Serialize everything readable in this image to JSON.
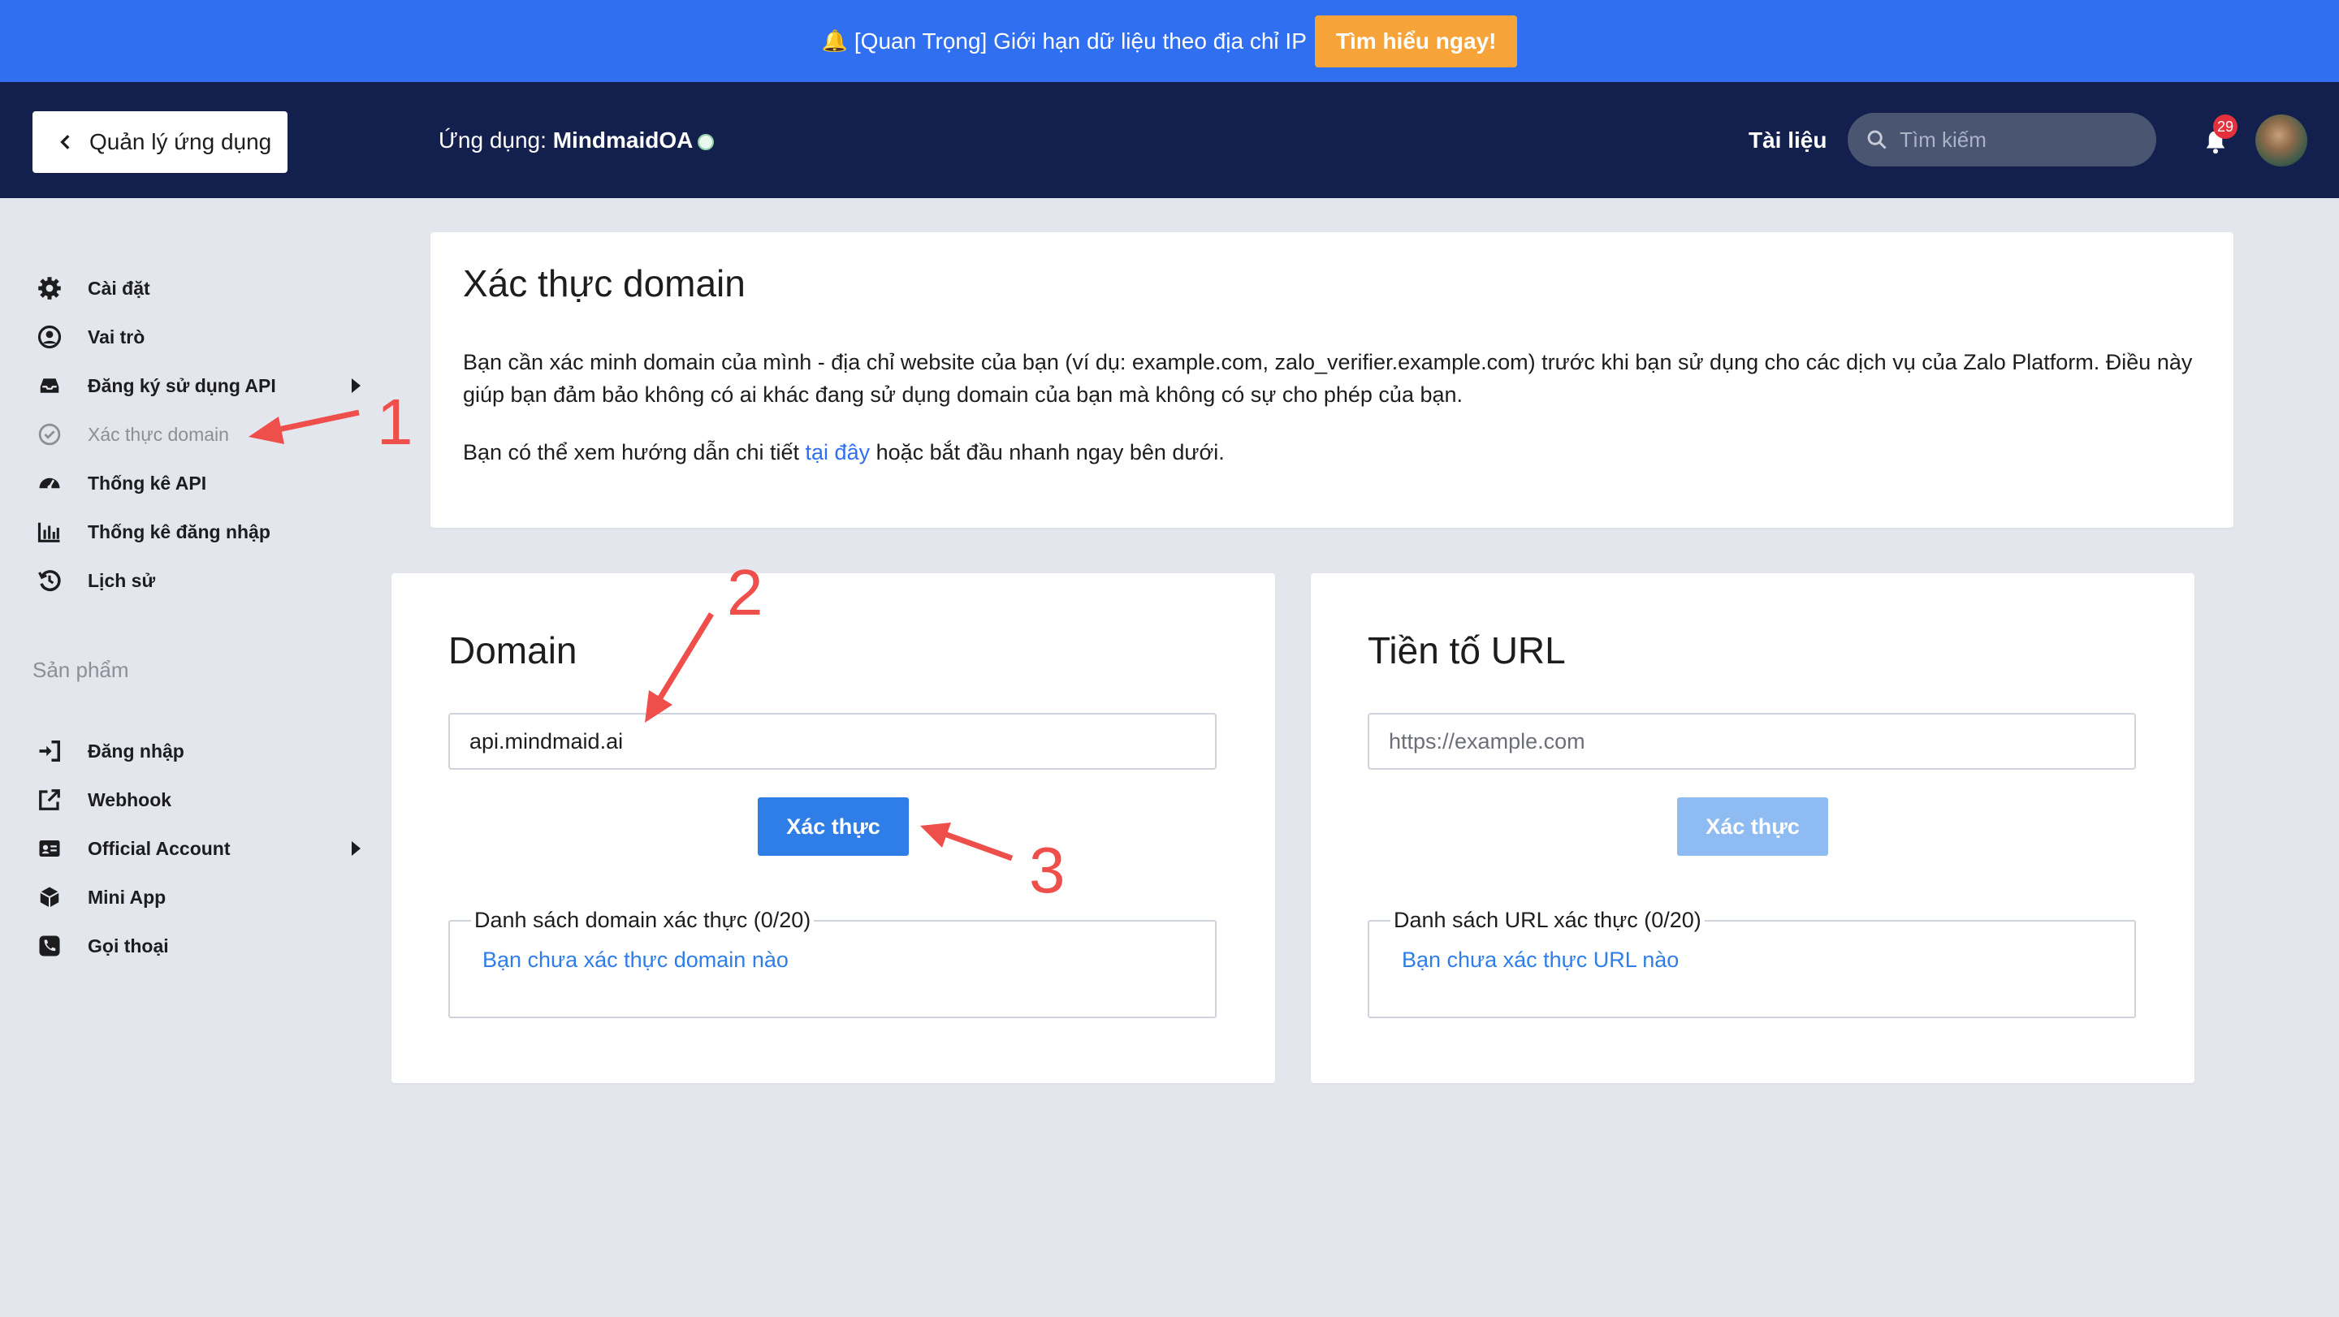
{
  "announcement": {
    "text": "[Quan Trọng] Giới hạn dữ liệu theo địa chỉ IP",
    "cta": "Tìm hiểu ngay!",
    "icon": "bell-emoji"
  },
  "header": {
    "back_label": "Quản lý ứng dụng",
    "app_prefix": "Ứng dụng: ",
    "app_name": "MindmaidOA",
    "docs_label": "Tài liệu",
    "search_placeholder": "Tìm kiếm",
    "notification_count": "29"
  },
  "sidebar": {
    "items": [
      {
        "label": "Cài đặt",
        "icon": "gear-icon"
      },
      {
        "label": "Vai trò",
        "icon": "user-circle-icon"
      },
      {
        "label": "Đăng ký sử dụng API",
        "icon": "inbox-icon"
      },
      {
        "label": "Xác thực domain",
        "icon": "check-circle-icon"
      },
      {
        "label": "Thống kê API",
        "icon": "dashboard-icon"
      },
      {
        "label": "Thống kê đăng nhập",
        "icon": "bar-chart-icon"
      },
      {
        "label": "Lịch sử",
        "icon": "history-icon"
      }
    ],
    "section_label": "Sản phẩm",
    "products": [
      {
        "label": "Đăng nhập",
        "icon": "sign-in-icon"
      },
      {
        "label": "Webhook",
        "icon": "external-link-icon"
      },
      {
        "label": "Official Account",
        "icon": "id-card-icon"
      },
      {
        "label": "Mini App",
        "icon": "cube-icon"
      },
      {
        "label": "Gọi thoại",
        "icon": "phone-icon"
      }
    ]
  },
  "intro": {
    "title": "Xác thực domain",
    "para1": "Bạn cần xác minh domain của mình - địa chỉ website của bạn (ví dụ: example.com, zalo_verifier.example.com) trước khi bạn sử dụng cho các dịch vụ của Zalo Platform. Điều này giúp bạn đảm bảo không có ai khác đang sử dụng domain của bạn mà không có sự cho phép của bạn.",
    "para2_before": "Bạn có thể xem hướng dẫn chi tiết ",
    "para2_link": "tại đây",
    "para2_after": " hoặc bắt đầu nhanh ngay bên dưới."
  },
  "domain_panel": {
    "title": "Domain",
    "input_value": "api.mindmaid.ai",
    "button": "Xác thực",
    "list_legend": "Danh sách domain xác thực (0/20)",
    "empty_text": "Bạn chưa xác thực domain nào"
  },
  "url_panel": {
    "title": "Tiền tố URL",
    "input_placeholder": "https://example.com",
    "button": "Xác thực",
    "list_legend": "Danh sách URL xác thực (0/20)",
    "empty_text": "Bạn chưa xác thực URL nào"
  },
  "annotations": [
    "1",
    "2",
    "3"
  ],
  "colors": {
    "announce_bg": "#2f6ff0",
    "header_bg": "#13204d",
    "cta_bg": "#f6a33a",
    "primary": "#2f7ee8",
    "annotation": "#ef4f4b"
  }
}
